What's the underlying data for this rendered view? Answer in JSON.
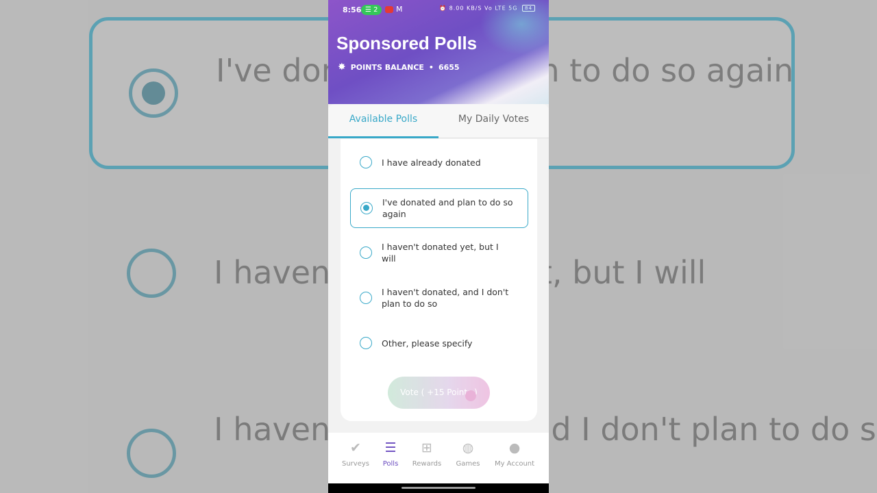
{
  "status": {
    "time": "8:56",
    "notif_count": "2",
    "right_icons": "8.00 KB/S  Vo LTE  5G ",
    "battery": "84"
  },
  "header": {
    "title": "Sponsored Polls",
    "balance_label": "POINTS BALANCE",
    "separator": "•",
    "balance_value": "6655"
  },
  "tabs": [
    {
      "label": "Available Polls",
      "active": true
    },
    {
      "label": "My Daily Votes",
      "active": false
    }
  ],
  "poll": {
    "options": [
      {
        "label": "I have already donated",
        "selected": false
      },
      {
        "label": "I've donated and plan to do so again",
        "selected": true
      },
      {
        "label": "I haven't donated yet, but I will",
        "selected": false
      },
      {
        "label": "I haven't donated, and I don't plan to do so",
        "selected": false
      },
      {
        "label": "Other, please specify",
        "selected": false
      }
    ],
    "vote_button": "Vote ( +15 Points )"
  },
  "nav": [
    {
      "label": "Surveys",
      "icon": "check-circle-icon"
    },
    {
      "label": "Polls",
      "icon": "polls-bars-icon",
      "active": true
    },
    {
      "label": "Rewards",
      "icon": "gift-icon"
    },
    {
      "label": "Games",
      "icon": "gamepad-icon"
    },
    {
      "label": "My Account",
      "icon": "user-icon"
    }
  ],
  "colors": {
    "accent": "#38a8c8",
    "brand_purple": "#6a4bbf"
  }
}
